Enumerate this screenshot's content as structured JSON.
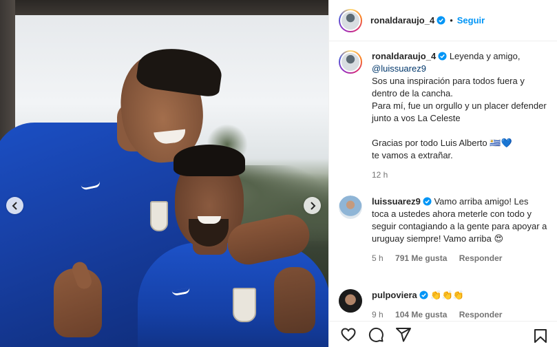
{
  "header": {
    "username": "ronaldaraujo_4",
    "separator": "•",
    "follow_label": "Seguir"
  },
  "caption": {
    "username": "ronaldaraujo_4",
    "line1": "Leyenda y amigo,",
    "mention": "@luissuarez9",
    "line2": "Sos una inspiración para todos fuera y dentro de la cancha.",
    "line3": "Para mí, fue un orgullo y un placer defender junto a vos La Celeste",
    "line4": "Gracias por todo Luis Alberto 🇺🇾💙",
    "line5": "te vamos a extrañar.",
    "time": "12 h"
  },
  "comments": [
    {
      "username": "luissuarez9",
      "text": "Vamo arriba amigo! Les toca a ustedes ahora meterle con todo y seguir contagiando a la gente para apoyar a uruguay siempre! Vamo arriba 😍",
      "time": "5 h",
      "likes": "791 Me gusta",
      "reply_label": "Responder"
    },
    {
      "username": "pulpoviera",
      "text": "👏👏👏",
      "time": "9 h",
      "likes": "104 Me gusta",
      "reply_label": "Responder"
    }
  ],
  "icons": {
    "like": "heart-icon",
    "comment": "comment-icon",
    "share": "share-icon",
    "save": "bookmark-icon",
    "prev": "chevron-left-icon",
    "next": "chevron-right-icon",
    "verified": "verified-badge-icon"
  },
  "colors": {
    "accent": "#0095f6",
    "verified": "#0095f6",
    "mention": "#00376b",
    "muted": "#737373"
  }
}
